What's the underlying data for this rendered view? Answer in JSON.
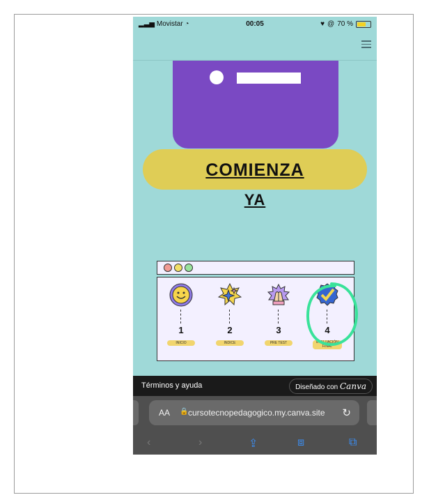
{
  "statusbar": {
    "carrier": "Movistar",
    "time": "00:05",
    "battery": "70 %"
  },
  "hero": {
    "title_line1": "COMIENZA",
    "title_line2": "YA"
  },
  "steps": [
    {
      "number": "1",
      "label": "INICIO"
    },
    {
      "number": "2",
      "label": "INDICE"
    },
    {
      "number": "3",
      "label": "PRE TEST"
    },
    {
      "number": "4",
      "label": "EVALUACIÓN FINAL"
    }
  ],
  "footer": {
    "terms": "Términos y ayuda",
    "designed_prefix": "Diseñado con",
    "designed_brand": "Canva"
  },
  "browser": {
    "text_size": "AA",
    "url": "cursotecnopedagogico.my.canva.site"
  },
  "colors": {
    "background": "#9fd9d8",
    "purple": "#7a49c3",
    "pill": "#dfcd56",
    "highlight": "#39e29a",
    "battery": "#f4d225"
  }
}
